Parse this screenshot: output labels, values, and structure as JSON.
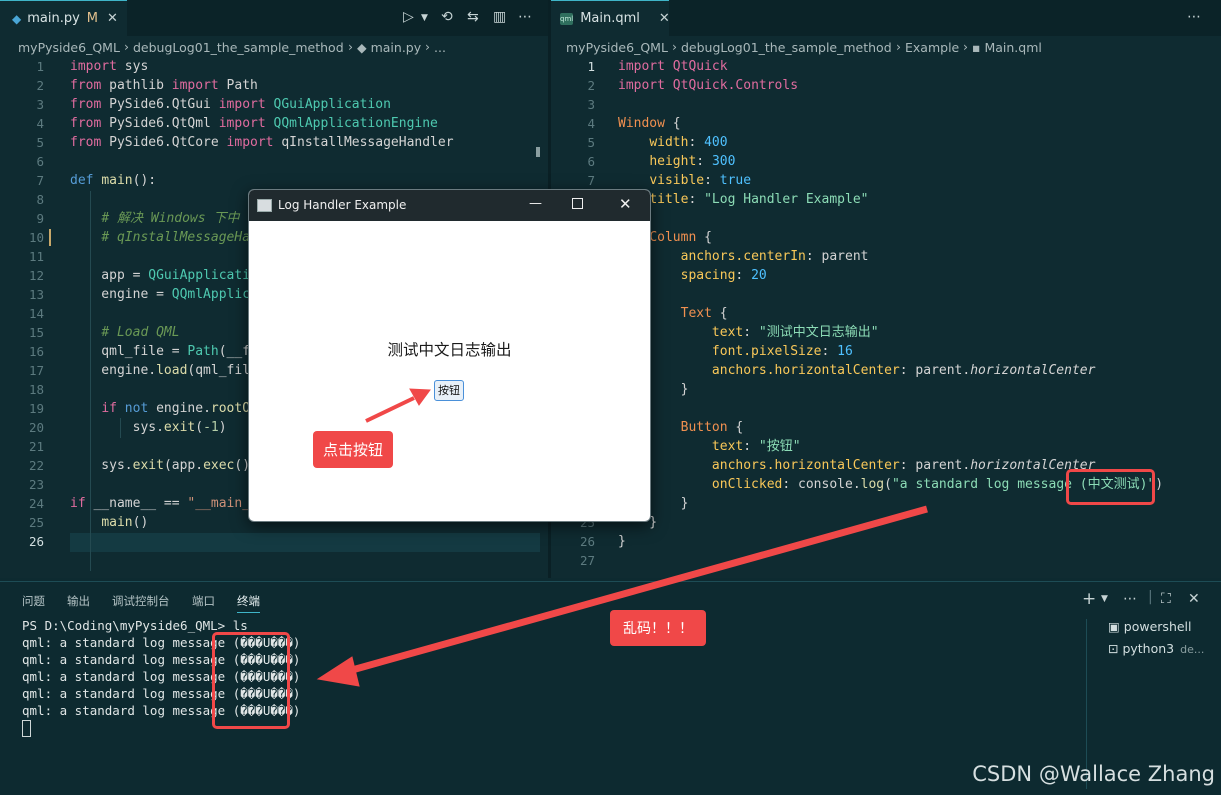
{
  "left_editor": {
    "tab": {
      "filename": "main.py",
      "status": "M",
      "close": "✕"
    },
    "breadcrumb": [
      "myPyside6_QML",
      "debugLog01_the_sample_method",
      "main.py",
      "..."
    ],
    "lines": [
      [
        [
          "kw",
          "import"
        ],
        [
          "t",
          " sys"
        ]
      ],
      [
        [
          "kw",
          "from"
        ],
        [
          "t",
          " pathlib "
        ],
        [
          "kw",
          "import"
        ],
        [
          "t",
          " Path"
        ]
      ],
      [
        [
          "kw",
          "from"
        ],
        [
          "t",
          " PySide6.QtGui "
        ],
        [
          "kw",
          "import"
        ],
        [
          "t",
          " "
        ],
        [
          "ty",
          "QGuiApplication"
        ]
      ],
      [
        [
          "kw",
          "from"
        ],
        [
          "t",
          " PySide6.QtQml "
        ],
        [
          "kw",
          "import"
        ],
        [
          "t",
          " "
        ],
        [
          "ty",
          "QQmlApplicationEngine"
        ]
      ],
      [
        [
          "kw",
          "from"
        ],
        [
          "t",
          " PySide6.QtCore "
        ],
        [
          "kw",
          "import"
        ],
        [
          "t",
          " qInstallMessageHandler"
        ]
      ],
      [],
      [
        [
          "bl",
          "def"
        ],
        [
          "t",
          " "
        ],
        [
          "fn",
          "main"
        ],
        [
          "t",
          "():"
        ]
      ],
      [],
      [
        [
          "t",
          "    "
        ],
        [
          "cm",
          "# 解决 Windows 下中"
        ]
      ],
      [
        [
          "t",
          "    "
        ],
        [
          "cm",
          "# qInstallMessageHa"
        ]
      ],
      [],
      [
        [
          "t",
          "    app = "
        ],
        [
          "ty",
          "QGuiApplicati"
        ]
      ],
      [
        [
          "t",
          "    engine = "
        ],
        [
          "ty",
          "QQmlApplic"
        ]
      ],
      [],
      [
        [
          "t",
          "    "
        ],
        [
          "cm",
          "# Load QML"
        ]
      ],
      [
        [
          "t",
          "    qml_file = "
        ],
        [
          "ty",
          "Path"
        ],
        [
          "t",
          "(__f"
        ]
      ],
      [
        [
          "t",
          "    engine."
        ],
        [
          "fn",
          "load"
        ],
        [
          "t",
          "(qml_fil"
        ]
      ],
      [],
      [
        [
          "t",
          "    "
        ],
        [
          "kw",
          "if"
        ],
        [
          "t",
          " "
        ],
        [
          "bl",
          "not"
        ],
        [
          "t",
          " engine."
        ],
        [
          "fn",
          "rootO"
        ]
      ],
      [
        [
          "t",
          "        sys."
        ],
        [
          "fn",
          "exit"
        ],
        [
          "t",
          "("
        ],
        [
          "nm",
          "-1"
        ],
        [
          "t",
          ")"
        ]
      ],
      [],
      [
        [
          "t",
          "    sys."
        ],
        [
          "fn",
          "exit"
        ],
        [
          "t",
          "(app."
        ],
        [
          "fn",
          "exec"
        ],
        [
          "t",
          "()"
        ]
      ],
      [],
      [
        [
          "kw",
          "if"
        ],
        [
          "t",
          " __name__ == "
        ],
        [
          "st",
          "\"__main_"
        ]
      ],
      [
        [
          "t",
          "    "
        ],
        [
          "fn",
          "main"
        ],
        [
          "t",
          "()"
        ]
      ],
      []
    ],
    "active_line": 26
  },
  "right_editor": {
    "tab": {
      "filename": "Main.qml",
      "close": "✕",
      "icon_text": "qml"
    },
    "breadcrumb": [
      "myPyside6_QML",
      "debugLog01_the_sample_method",
      "Example",
      "Main.qml"
    ],
    "lines": [
      [
        [
          "qpr",
          "import"
        ],
        [
          "t",
          " "
        ],
        [
          "qpr",
          "QtQuick"
        ]
      ],
      [
        [
          "qpr",
          "import"
        ],
        [
          "t",
          " "
        ],
        [
          "qpr",
          "QtQuick.Controls"
        ]
      ],
      [],
      [
        [
          "qty",
          "Window"
        ],
        [
          "t",
          " {"
        ]
      ],
      [
        [
          "t",
          "    "
        ],
        [
          "qid",
          "width"
        ],
        [
          "t",
          ": "
        ],
        [
          "qval",
          "400"
        ]
      ],
      [
        [
          "t",
          "    "
        ],
        [
          "qid",
          "height"
        ],
        [
          "t",
          ": "
        ],
        [
          "qval",
          "300"
        ]
      ],
      [
        [
          "t",
          "    "
        ],
        [
          "qid",
          "visible"
        ],
        [
          "t",
          ": "
        ],
        [
          "qval",
          "true"
        ]
      ],
      [
        [
          "t",
          "    "
        ],
        [
          "qid",
          "title"
        ],
        [
          "t",
          ": "
        ],
        [
          "qstr",
          "\"Log Handler Example\""
        ]
      ],
      [],
      [
        [
          "t",
          "    "
        ],
        [
          "qty",
          "Column"
        ],
        [
          "t",
          " {"
        ]
      ],
      [
        [
          "t",
          "        "
        ],
        [
          "qid",
          "anchors.centerIn"
        ],
        [
          "t",
          ": parent"
        ]
      ],
      [
        [
          "t",
          "        "
        ],
        [
          "qid",
          "spacing"
        ],
        [
          "t",
          ": "
        ],
        [
          "qval",
          "20"
        ]
      ],
      [],
      [
        [
          "t",
          "        "
        ],
        [
          "qty",
          "Text"
        ],
        [
          "t",
          " {"
        ]
      ],
      [
        [
          "t",
          "            "
        ],
        [
          "qid",
          "text"
        ],
        [
          "t",
          ": "
        ],
        [
          "qstr",
          "\"测试中文日志输出\""
        ]
      ],
      [
        [
          "t",
          "            "
        ],
        [
          "qid",
          "font.pixelSize"
        ],
        [
          "t",
          ": "
        ],
        [
          "qval",
          "16"
        ]
      ],
      [
        [
          "t",
          "            "
        ],
        [
          "qid",
          "anchors.horizontalCenter"
        ],
        [
          "t",
          ": parent."
        ],
        [
          "qit",
          "horizontalCenter"
        ]
      ],
      [
        [
          "t",
          "        }"
        ]
      ],
      [],
      [
        [
          "t",
          "        "
        ],
        [
          "qty",
          "Button"
        ],
        [
          "t",
          " {"
        ]
      ],
      [
        [
          "t",
          "            "
        ],
        [
          "qid",
          "text"
        ],
        [
          "t",
          ": "
        ],
        [
          "qstr",
          "\"按钮\""
        ]
      ],
      [
        [
          "t",
          "            "
        ],
        [
          "qid",
          "anchors.horizontalCenter"
        ],
        [
          "t",
          ": parent."
        ],
        [
          "qit",
          "horizontalCenter"
        ]
      ],
      [
        [
          "t",
          "            "
        ],
        [
          "qid",
          "onClicked"
        ],
        [
          "t",
          ": console."
        ],
        [
          "fn",
          "log"
        ],
        [
          "t",
          "("
        ],
        [
          "qstr",
          "\"a standard log message (中文测试)\""
        ],
        [
          "t",
          ")"
        ]
      ],
      [
        [
          "t",
          "        }"
        ]
      ],
      [
        [
          "t",
          "    }"
        ]
      ],
      [
        [
          "t",
          "}"
        ]
      ],
      []
    ],
    "active_line": 1
  },
  "panel": {
    "tabs": [
      "问题",
      "输出",
      "调试控制台",
      "端口",
      "终端"
    ],
    "active_tab": "终端",
    "terminal_lines": [
      "PS D:\\Coding\\myPyside6_QML> ls",
      "qml: a standard log message (���U���)",
      "qml: a standard log message (���U���)",
      "qml: a standard log message (���U���)",
      "qml: a standard log message (���U���)",
      "qml: a standard log message (���U���)"
    ],
    "shells": [
      {
        "name": "powershell",
        "extra": ""
      },
      {
        "name": "python3",
        "extra": "de..."
      }
    ]
  },
  "dialog": {
    "title": "Log Handler Example",
    "text": "测试中文日志输出",
    "button": "按钮"
  },
  "annotations": {
    "click_label": "点击按钮",
    "garbled_label": "乱码！！！",
    "color": "#f04848"
  },
  "watermark": "CSDN @Wallace Zhang"
}
